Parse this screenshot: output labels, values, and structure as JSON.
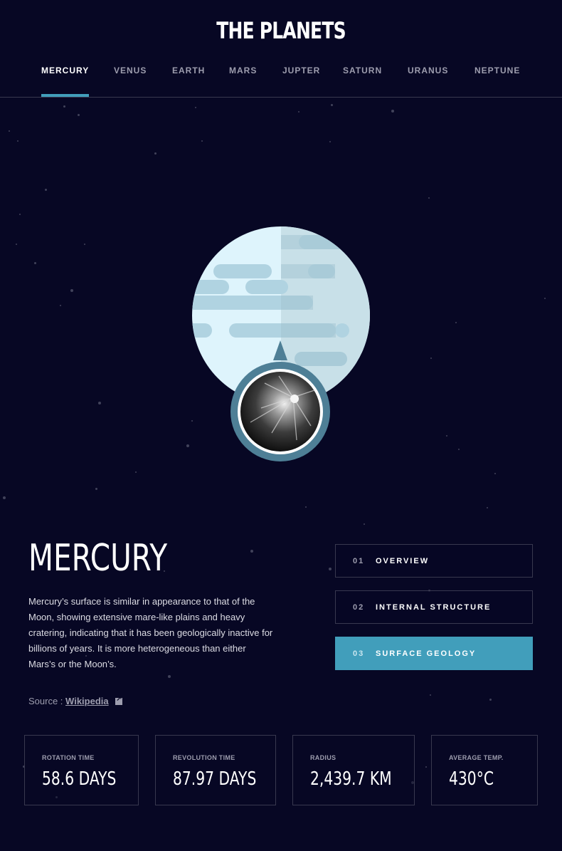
{
  "app_title": "THE PLANETS",
  "nav": [
    {
      "label": "MERCURY",
      "active": true
    },
    {
      "label": "VENUS",
      "active": false
    },
    {
      "label": "EARTH",
      "active": false
    },
    {
      "label": "MARS",
      "active": false
    },
    {
      "label": "JUPTER",
      "active": false
    },
    {
      "label": "SATURN",
      "active": false
    },
    {
      "label": "URANUS",
      "active": false
    },
    {
      "label": "NEPTUNE",
      "active": false
    }
  ],
  "planet": {
    "name": "MERCURY",
    "description": "Mercury’s surface is similar in appearance to that of the Moon, showing extensive mare-like plains and heavy cratering, indicating that it has been geologically inactive for billions of years. It is more heterogeneous than either Mars’s or the Moon’s.",
    "source_prefix": "Source :",
    "source_link": "Wikipedia",
    "source_icon": "external-link-icon"
  },
  "tabs": [
    {
      "num": "01",
      "label": "OVERVIEW",
      "active": false
    },
    {
      "num": "02",
      "label": "INTERNAL STRUCTURE",
      "active": false
    },
    {
      "num": "03",
      "label": "SURFACE GEOLOGY",
      "active": true
    }
  ],
  "stats": [
    {
      "label": "ROTATION TIME",
      "value": "58.6 DAYS"
    },
    {
      "label": "REVOLUTION TIME",
      "value": "87.97 DAYS"
    },
    {
      "label": "RADIUS",
      "value": "2,439.7 KM"
    },
    {
      "label": "AVERAGE TEMP.",
      "value": "430°C"
    }
  ],
  "colors": {
    "background": "#070724",
    "accent": "#419ebb",
    "border": "#38384f",
    "muted_text": "#9d9dae",
    "planet_light": "#def4fc",
    "planet_shade": "#c8e0e8",
    "planet_spots": "#b0d3e1"
  }
}
